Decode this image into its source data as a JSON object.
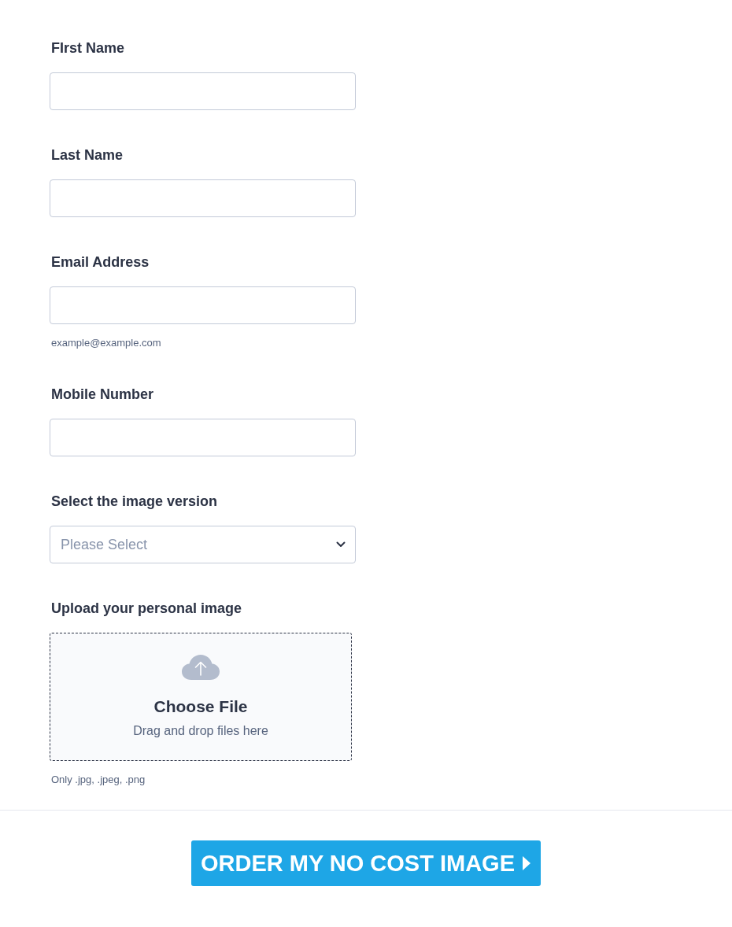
{
  "fields": [
    {
      "kind": "text",
      "label": "FIrst Name"
    },
    {
      "kind": "text",
      "label": "Last Name"
    },
    {
      "kind": "text",
      "label": "Email Address",
      "helper": "example@example.com"
    },
    {
      "kind": "text",
      "label": "Mobile Number"
    },
    {
      "kind": "select",
      "label": "Select the image version",
      "placeholder": "Please Select"
    },
    {
      "kind": "upload",
      "label": "Upload your personal image",
      "title": "Choose File",
      "hint": "Drag and drop files here",
      "helper": "Only .jpg, .jpeg, .png"
    }
  ],
  "submit": {
    "label": "ORDER MY NO COST IMAGE"
  }
}
